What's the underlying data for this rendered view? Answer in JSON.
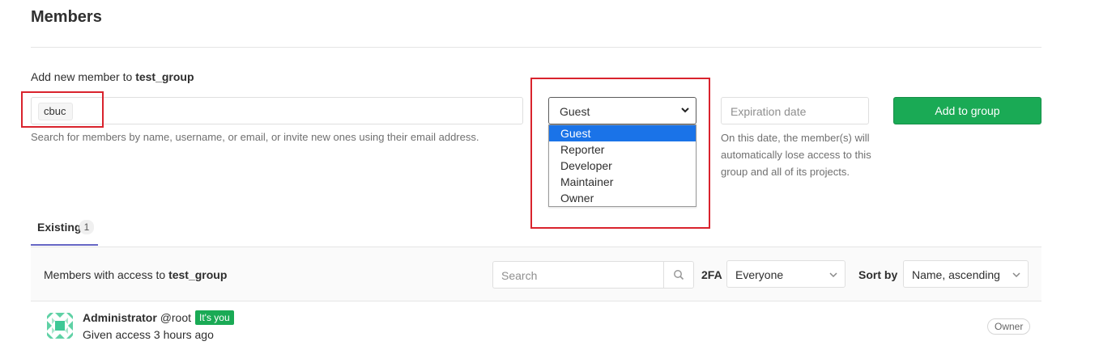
{
  "page": {
    "title": "Members"
  },
  "add_member": {
    "label_prefix": "Add new member to",
    "group_name": "test_group",
    "token": "cbuc",
    "help_text": "Search for members by name, username, or email, or invite new ones using their email address."
  },
  "role_select": {
    "selected": "Guest",
    "options": [
      "Guest",
      "Reporter",
      "Developer",
      "Maintainer",
      "Owner"
    ]
  },
  "expiration": {
    "placeholder": "Expiration date",
    "help": "On this date, the member(s) will automatically lose access to this group and all of its projects."
  },
  "add_button": {
    "label": "Add to group"
  },
  "tabs": {
    "existing_label": "Existing",
    "existing_count": "1"
  },
  "members_bar": {
    "text_prefix": "Members with access to",
    "group_name": "test_group",
    "search_placeholder": "Search",
    "twofa_label": "2FA",
    "twofa_value": "Everyone",
    "sort_label": "Sort by",
    "sort_value": "Name, ascending"
  },
  "members": [
    {
      "name": "Administrator",
      "username": "@root",
      "badge": "It's you",
      "access": "Given access 3 hours ago",
      "role": "Owner"
    }
  ],
  "colors": {
    "highlight": "#d9232d",
    "primary_green": "#1aaa55",
    "tab_underline": "#6666c4",
    "selected_option": "#1a73e8"
  }
}
